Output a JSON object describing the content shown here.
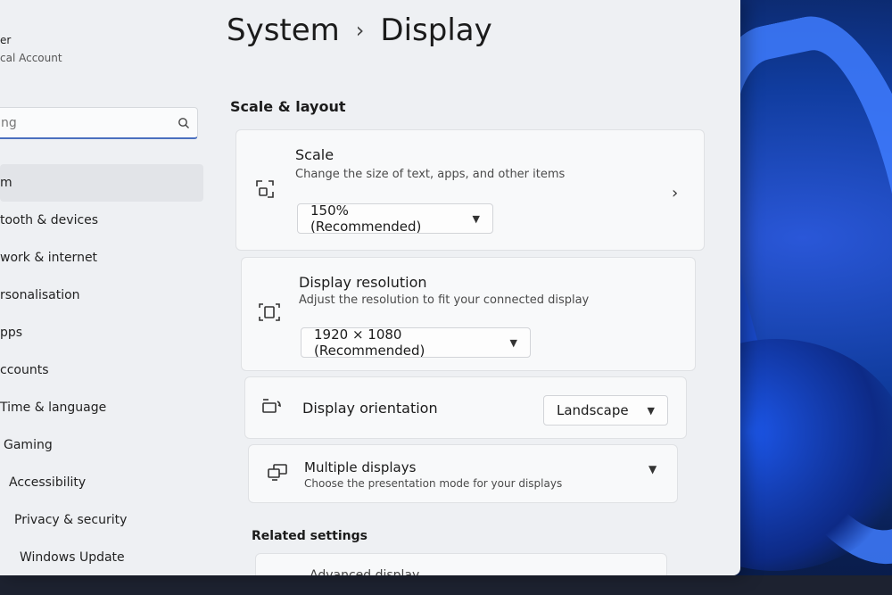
{
  "user": {
    "name": "er",
    "account": "cal Account"
  },
  "search": {
    "value": "ng"
  },
  "nav": [
    {
      "label": "m",
      "active": true
    },
    {
      "label": "tooth & devices"
    },
    {
      "label": "work & internet"
    },
    {
      "label": "rsonalisation"
    },
    {
      "label": "pps"
    },
    {
      "label": "ccounts"
    },
    {
      "label": "Time & language"
    },
    {
      "label": "Gaming"
    },
    {
      "label": "Accessibility"
    },
    {
      "label": "Privacy & security"
    },
    {
      "label": "Windows Update"
    }
  ],
  "breadcrumb": {
    "parent": "System",
    "separator": "›",
    "current": "Display"
  },
  "section": {
    "title": "Scale & layout"
  },
  "scale": {
    "title": "Scale",
    "subtitle": "Change the size of text, apps, and other items",
    "value": "150% (Recommended)"
  },
  "resolution": {
    "title": "Display resolution",
    "subtitle": "Adjust the resolution to fit your connected display",
    "value": "1920 × 1080 (Recommended)"
  },
  "orientation": {
    "title": "Display orientation",
    "value": "Landscape"
  },
  "multiple": {
    "title": "Multiple displays",
    "subtitle": "Choose the presentation mode for your displays"
  },
  "related": {
    "title": "Related settings",
    "advanced": "Advanced display"
  },
  "colors": {
    "accent": "#4a6fbf",
    "window_bg": "#eef0f3",
    "card_bg": "#f8f9fa"
  }
}
